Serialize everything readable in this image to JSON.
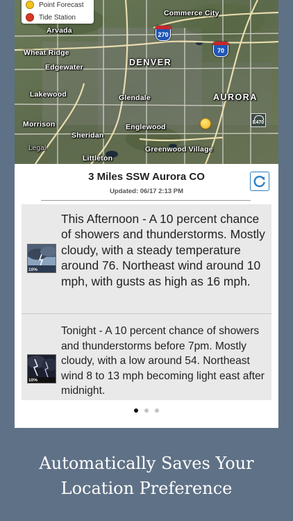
{
  "map": {
    "legend": [
      {
        "label": "Point Forecast",
        "color": "#f6c21a"
      },
      {
        "label": "Tide Station",
        "color": "#d93a24"
      }
    ],
    "labels": {
      "arvada": "Arvada",
      "commerce_city": "Commerce City",
      "wheat_ridge": "Wheat Ridge",
      "edgewater": "Edgewater",
      "denver": "DENVER",
      "glendale": "Glendale",
      "aurora": "AURORA",
      "lakewood": "Lakewood",
      "morrison": "Morrison",
      "englewood": "Englewood",
      "sheridan": "Sheridan",
      "littleton": "Littleton",
      "greenwood_village": "Greenwood Village",
      "legal": "Legal"
    },
    "shields": {
      "i270": "270",
      "i70": "70",
      "e470": "E470"
    }
  },
  "header": {
    "location": "3 Miles SSW Aurora CO",
    "updated": "Updated: 06/17 2:13 PM"
  },
  "forecast": [
    {
      "text": "This Afternoon - A 10 percent chance of showers and thunderstorms.  Mostly cloudy, with a steady temperature around 76. Northeast wind around 10 mph, with gusts as high as 16 mph.",
      "icon": "thunderstorm-day-icon",
      "pop": "10%"
    },
    {
      "text": "Tonight - A 10 percent chance of showers and thunderstorms before 7pm.  Mostly cloudy, with a low around 54. Northeast wind 8 to 13 mph becoming light east  after midnight.",
      "icon": "thunderstorm-night-icon",
      "pop": "10%"
    }
  ],
  "pager": {
    "count": 3,
    "active": 1
  },
  "caption": {
    "line1": "Automatically Saves Your",
    "line2": "Location Preference"
  },
  "colors": {
    "background": "#5f7186",
    "refresh_accent": "#2d7fc1"
  }
}
